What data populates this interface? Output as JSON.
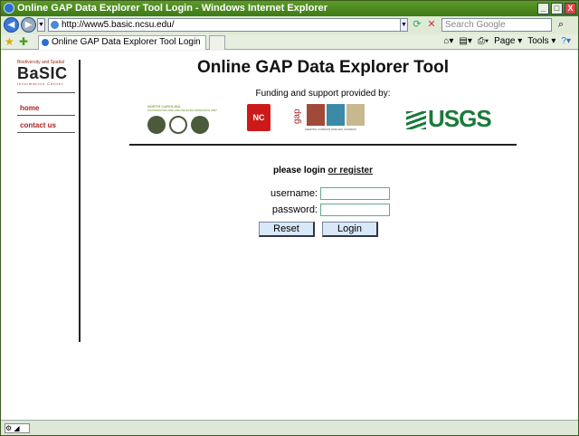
{
  "window": {
    "title": "Online GAP Data Explorer Tool Login - Windows Internet Explorer",
    "minimize": "_",
    "maximize": "□",
    "close": "X"
  },
  "addressbar": {
    "url": "http://www5.basic.ncsu.edu/",
    "search_placeholder": "Search Google"
  },
  "tabbar": {
    "tab_label": "Online GAP Data Explorer Tool Login",
    "tools": [
      "Page ▾",
      "Tools ▾"
    ]
  },
  "sidebar": {
    "logo_top": "Biodiversity and Spatial",
    "logo_main": "BaSIC",
    "logo_sub": "Information Center",
    "links": [
      "home",
      "contact us"
    ]
  },
  "main": {
    "title": "Online GAP Data Explorer Tool",
    "funding": "Funding and support provided by:",
    "logos": {
      "nc": "NORTH CAROLINA",
      "nc_sub": "COOPERATIVE FISH AND WILDLIFE RESEARCH UNIT",
      "ncsu": "NC",
      "gap": "gap",
      "gap_sub": "KEEPING COMMON SPECIES COMMON",
      "usgs": "USGS"
    },
    "login_prefix": "please login",
    "login_link": "or register",
    "username_label": "username:",
    "password_label": "password:",
    "reset_label": "Reset",
    "login_label": "Login"
  },
  "colors": {
    "title_bar": "#3e7a16",
    "accent_red": "#b02020",
    "usgs_green": "#1a7a3a",
    "button_bg": "#d8e8f8"
  }
}
